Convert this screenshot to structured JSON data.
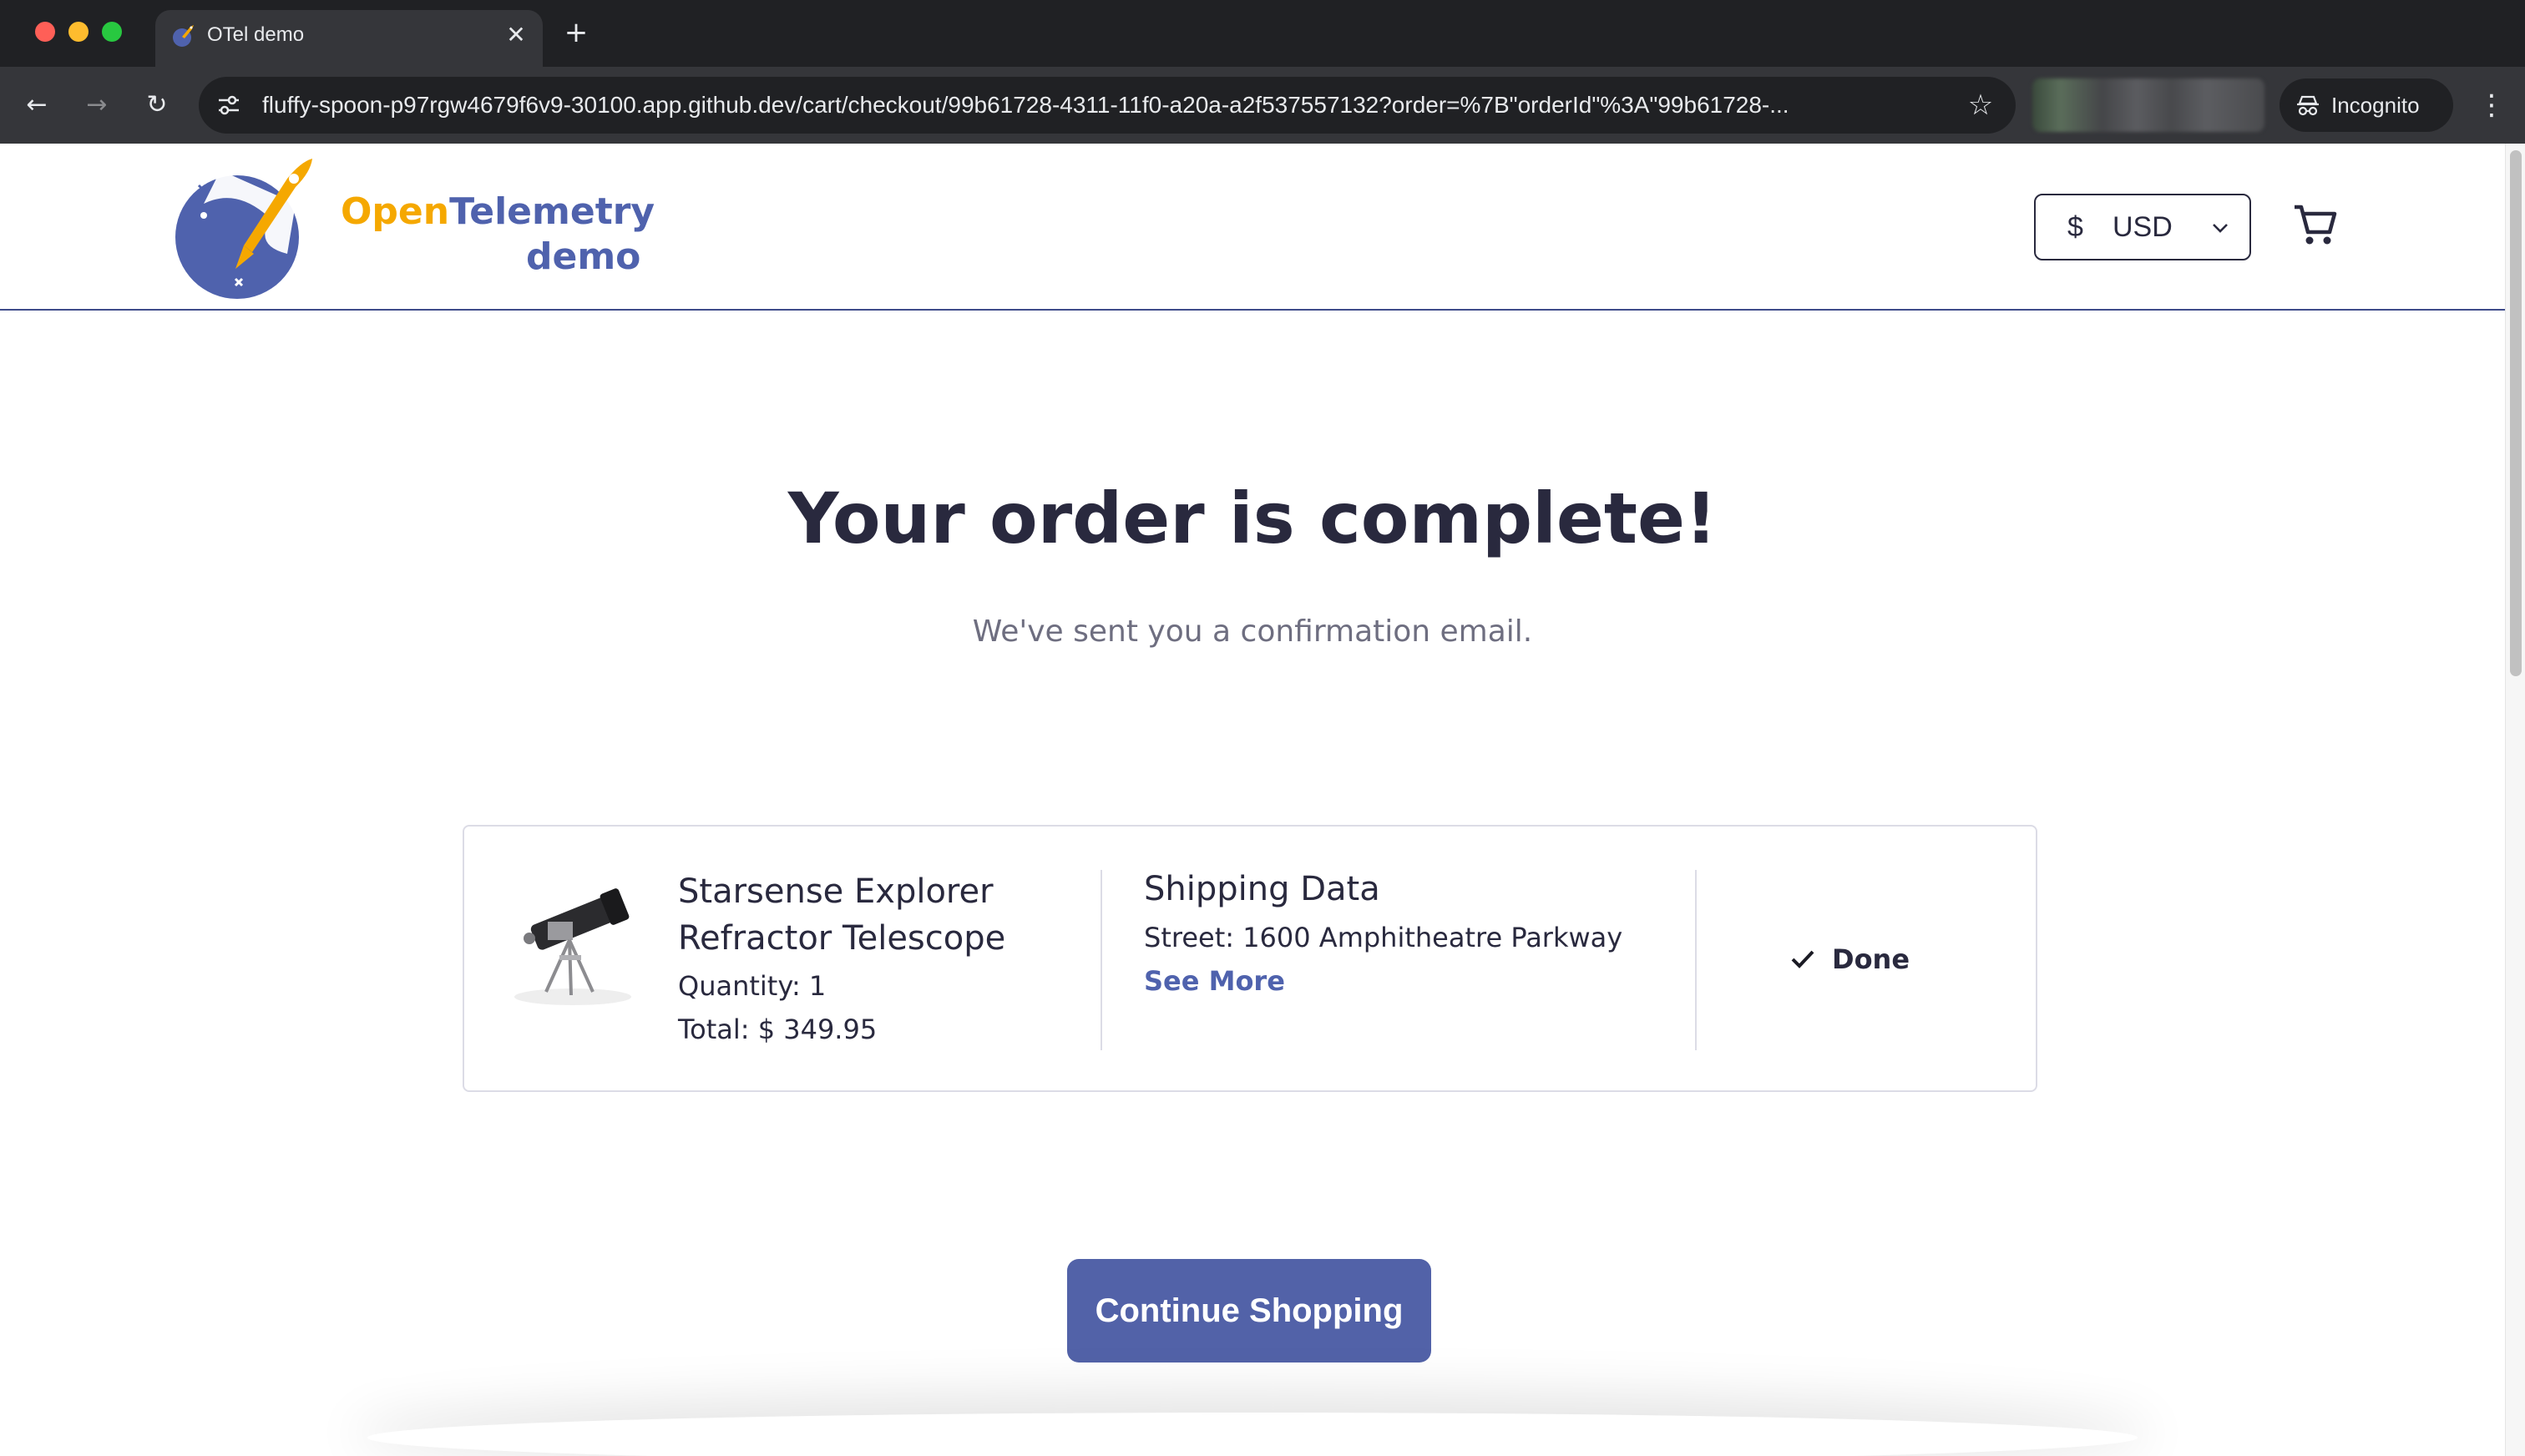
{
  "browser": {
    "tab": {
      "title": "OTel demo",
      "close_glyph": "✕"
    },
    "new_tab_glyph": "+",
    "nav": {
      "back_glyph": "←",
      "forward_glyph": "→",
      "reload_glyph": "↻"
    },
    "address_bar": {
      "url": "fluffy-spoon-p97rgw4679f6v9-30100.app.github.dev/cart/checkout/99b61728-4311-11f0-a20a-a2f537557132?order=%7B\"orderId\"%3A\"99b61728-..."
    },
    "incognito_label": "Incognito",
    "menu_glyph": "⋮",
    "star_glyph": "☆",
    "icons": [
      "site-info-icon",
      "star-icon",
      "incognito-icon",
      "menu-icon"
    ]
  },
  "header": {
    "logo": {
      "line1_part1": "Open",
      "line1_part2": "Telemetry",
      "line2": "demo"
    },
    "currency": {
      "symbol": "$",
      "code": "USD"
    },
    "icons": [
      "rocket-logo-icon",
      "chevron-down-icon",
      "cart-icon"
    ]
  },
  "main": {
    "title": "Your order is complete!",
    "subtitle": "We've sent you a confirmation email.",
    "order_item": {
      "name": "Starsense Explorer Refractor Telescope",
      "quantity": "Quantity: 1",
      "total": "Total: $ 349.95",
      "image_icon": "telescope-icon"
    },
    "shipping": {
      "title": "Shipping Data",
      "street": "Street: 1600 Amphitheatre Parkway",
      "see_more": "See More"
    },
    "status": {
      "label": "Done",
      "icon": "checkmark-icon"
    },
    "continue_button": "Continue Shopping"
  },
  "colors": {
    "brand_primary": "#5262a8",
    "brand_orange": "#f5a800",
    "text_dark": "#29293e",
    "text_muted": "#6e6e80",
    "chrome_dark": "#202124",
    "chrome_toolbar": "#35363a"
  }
}
